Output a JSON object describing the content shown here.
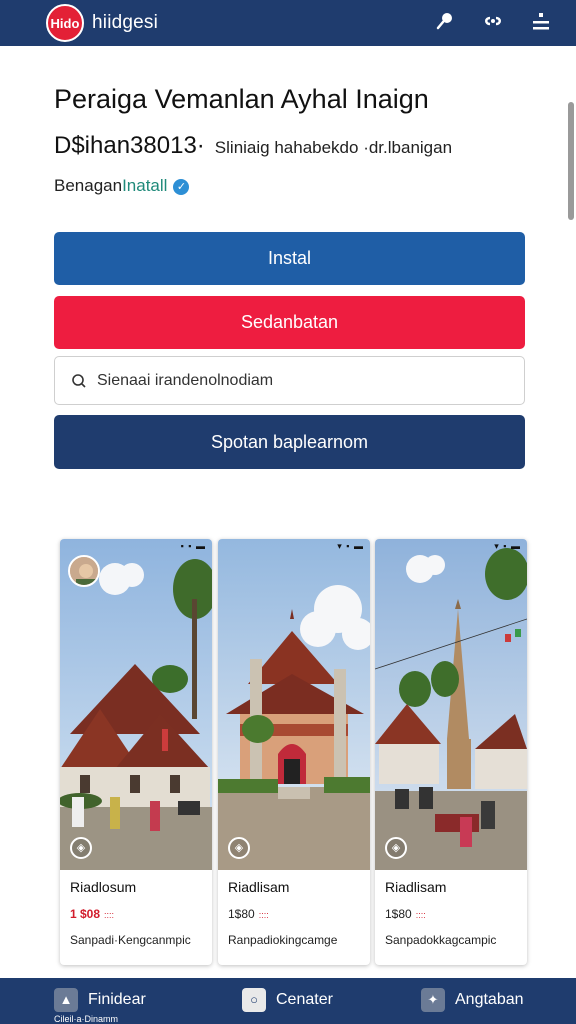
{
  "header": {
    "logo_text": "Hido",
    "app_name": "hiidgesi",
    "icons": [
      "pin-icon",
      "link-icon",
      "menu-icon"
    ]
  },
  "main": {
    "title": "Peraiga Vemanlan Ayhal Inaign",
    "subtitle_big": "D$ihan38013·",
    "subtitle_small": "Sliniaig hahabekdo ·dr.lbanigan",
    "install_prefix": "Benagan",
    "install_link": "Inatall"
  },
  "buttons": {
    "install": "Instal",
    "red": "Sedanbatan",
    "search_placeholder": "Sienaai irandenolnodiam",
    "navy": "Spotan baplearnom"
  },
  "cards": [
    {
      "name": "Riadlosum",
      "price": "1 $08",
      "price_suffix": "::::",
      "desc": "Sanpadi·Kengcanmpic",
      "status": "▪ ▪ ▬"
    },
    {
      "name": "Riadlisam",
      "price": "1$80",
      "price_suffix": "::::",
      "desc": "Ranpadiokingcamge",
      "status": "▾ ▪ ▬"
    },
    {
      "name": "Riadlisam",
      "price": "1$80",
      "price_suffix": "::::",
      "desc": "Sanpadokkagcampic",
      "status": "▾ ▪ ▬"
    }
  ],
  "bottom_nav": {
    "items": [
      {
        "label": "Finidear",
        "icon": "logo-icon"
      },
      {
        "label": "Cenater",
        "icon": "circle-icon"
      },
      {
        "label": "Angtaban",
        "icon": "compass-icon"
      }
    ],
    "sub_label": "Cileil·a·Dinamm"
  },
  "colors": {
    "navy": "#1f3c6e",
    "blue": "#1f5ea6",
    "red": "#ee1d40",
    "teal_link": "#1f8a7a"
  }
}
